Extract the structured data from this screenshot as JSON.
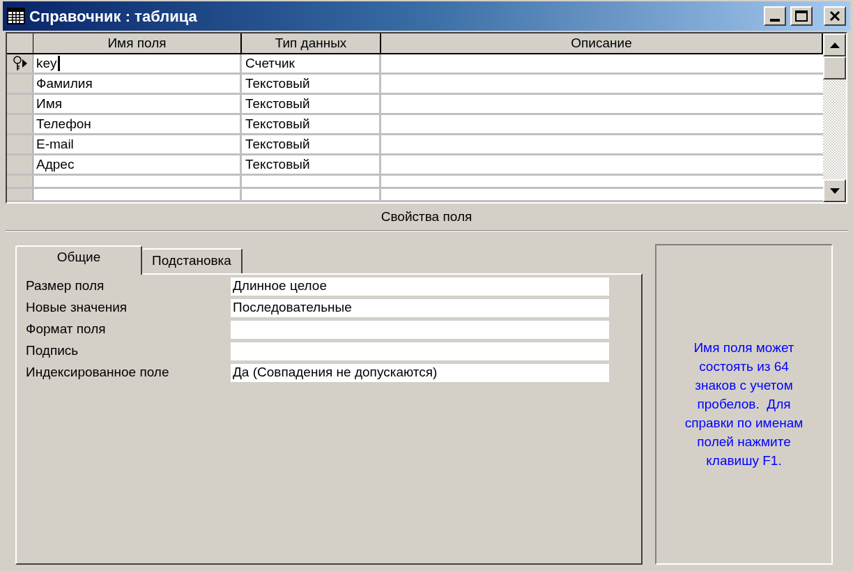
{
  "window": {
    "title": "Справочник : таблица"
  },
  "table": {
    "columns": [
      "Имя поля",
      "Тип данных",
      "Описание"
    ],
    "rows": [
      {
        "name": "key",
        "type": "Счетчик",
        "primary_key": true,
        "current": true
      },
      {
        "name": "Фамилия",
        "type": "Текстовый",
        "primary_key": false,
        "current": false
      },
      {
        "name": "Имя",
        "type": "Текстовый",
        "primary_key": false,
        "current": false
      },
      {
        "name": "Телефон",
        "type": "Текстовый",
        "primary_key": false,
        "current": false
      },
      {
        "name": "E-mail",
        "type": "Текстовый",
        "primary_key": false,
        "current": false
      },
      {
        "name": "Адрес",
        "type": "Текстовый",
        "primary_key": false,
        "current": false
      }
    ]
  },
  "properties_title": "Свойства поля",
  "tabs": [
    {
      "label": "Общие",
      "selected": true
    },
    {
      "label": "Подстановка",
      "selected": false
    }
  ],
  "properties": [
    {
      "label": "Размер поля",
      "value": "Длинное целое"
    },
    {
      "label": "Новые значения",
      "value": "Последовательные"
    },
    {
      "label": "Формат поля"
    },
    {
      "label": "Подпись"
    },
    {
      "label": "Индексированное поле",
      "value": "Да (Совпадения не допускаются)"
    }
  ],
  "help_text": "Имя поля может состоять из 64 знаков с учетом пробелов.  Для справки по именам полей нажмите клавишу F1."
}
